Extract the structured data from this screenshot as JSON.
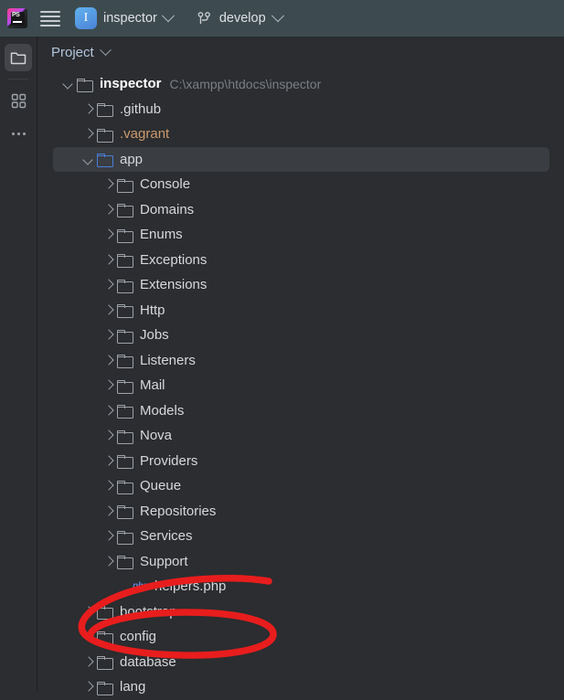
{
  "toolbar": {
    "ide_logo_name": "phpstorm-logo",
    "menu_label": "Main Menu",
    "project_name": "inspector",
    "project_icon_letter": "I",
    "branch_name": "develop",
    "branch_icon_name": "git-branch-icon"
  },
  "rail": {
    "items": [
      {
        "name": "project-tool-window",
        "icon": "folder-icon",
        "active": true
      },
      {
        "name": "structure-tool-window",
        "icon": "blocks-icon",
        "active": false
      },
      {
        "name": "more-tool-windows",
        "icon": "more-dots-icon",
        "active": false
      }
    ]
  },
  "panel": {
    "title": "Project"
  },
  "tree": {
    "rows": [
      {
        "indent": "ind1",
        "arrow": "open",
        "icon": "folder",
        "label": "inspector",
        "style": "root",
        "path": "C:\\xampp\\htdocs\\inspector",
        "selected": false
      },
      {
        "indent": "ind2",
        "arrow": "closed",
        "icon": "folder",
        "label": ".github",
        "style": "",
        "path": "",
        "selected": false
      },
      {
        "indent": "ind2",
        "arrow": "closed",
        "icon": "folder",
        "label": ".vagrant",
        "style": "ignored",
        "path": "",
        "selected": false
      },
      {
        "indent": "ind2",
        "arrow": "open",
        "icon": "folder-blue",
        "label": "app",
        "style": "",
        "path": "",
        "selected": true
      },
      {
        "indent": "ind3",
        "arrow": "closed",
        "icon": "folder",
        "label": "Console",
        "style": "",
        "path": "",
        "selected": false
      },
      {
        "indent": "ind3",
        "arrow": "closed",
        "icon": "folder",
        "label": "Domains",
        "style": "",
        "path": "",
        "selected": false
      },
      {
        "indent": "ind3",
        "arrow": "closed",
        "icon": "folder",
        "label": "Enums",
        "style": "",
        "path": "",
        "selected": false
      },
      {
        "indent": "ind3",
        "arrow": "closed",
        "icon": "folder",
        "label": "Exceptions",
        "style": "",
        "path": "",
        "selected": false
      },
      {
        "indent": "ind3",
        "arrow": "closed",
        "icon": "folder",
        "label": "Extensions",
        "style": "",
        "path": "",
        "selected": false
      },
      {
        "indent": "ind3",
        "arrow": "closed",
        "icon": "folder",
        "label": "Http",
        "style": "",
        "path": "",
        "selected": false
      },
      {
        "indent": "ind3",
        "arrow": "closed",
        "icon": "folder",
        "label": "Jobs",
        "style": "",
        "path": "",
        "selected": false
      },
      {
        "indent": "ind3",
        "arrow": "closed",
        "icon": "folder",
        "label": "Listeners",
        "style": "",
        "path": "",
        "selected": false
      },
      {
        "indent": "ind3",
        "arrow": "closed",
        "icon": "folder",
        "label": "Mail",
        "style": "",
        "path": "",
        "selected": false
      },
      {
        "indent": "ind3",
        "arrow": "closed",
        "icon": "folder",
        "label": "Models",
        "style": "",
        "path": "",
        "selected": false
      },
      {
        "indent": "ind3",
        "arrow": "closed",
        "icon": "folder",
        "label": "Nova",
        "style": "",
        "path": "",
        "selected": false
      },
      {
        "indent": "ind3",
        "arrow": "closed",
        "icon": "folder",
        "label": "Providers",
        "style": "",
        "path": "",
        "selected": false
      },
      {
        "indent": "ind3",
        "arrow": "closed",
        "icon": "folder",
        "label": "Queue",
        "style": "",
        "path": "",
        "selected": false
      },
      {
        "indent": "ind3",
        "arrow": "closed",
        "icon": "folder",
        "label": "Repositories",
        "style": "",
        "path": "",
        "selected": false
      },
      {
        "indent": "ind3",
        "arrow": "closed",
        "icon": "folder",
        "label": "Services",
        "style": "",
        "path": "",
        "selected": false
      },
      {
        "indent": "ind3",
        "arrow": "closed",
        "icon": "folder",
        "label": "Support",
        "style": "",
        "path": "",
        "selected": false
      },
      {
        "indent": "ind3n",
        "arrow": "none",
        "icon": "php",
        "label": "helpers.php",
        "style": "",
        "path": "",
        "selected": false
      },
      {
        "indent": "ind2",
        "arrow": "closed",
        "icon": "folder",
        "label": "bootstrap",
        "style": "",
        "path": "",
        "selected": false
      },
      {
        "indent": "ind2",
        "arrow": "closed",
        "icon": "folder",
        "label": "config",
        "style": "",
        "path": "",
        "selected": false
      },
      {
        "indent": "ind2",
        "arrow": "closed",
        "icon": "folder",
        "label": "database",
        "style": "",
        "path": "",
        "selected": false
      },
      {
        "indent": "ind2",
        "arrow": "closed",
        "icon": "folder",
        "label": "lang",
        "style": "",
        "path": "",
        "selected": false
      }
    ]
  },
  "annotation": {
    "name": "red-ellipse-highlight",
    "target": "helpers.php",
    "color": "#e81d1d"
  },
  "colors": {
    "toolbar_bg": "#3d4b50",
    "panel_bg": "#2b2d30",
    "selection_bg": "#3a3d42",
    "text": "#d6d8dc",
    "ignored_text": "#cc9a6e",
    "path_text": "#7a7e85",
    "accent_blue": "#4a7ed8",
    "annotation_red": "#e81d1d"
  }
}
